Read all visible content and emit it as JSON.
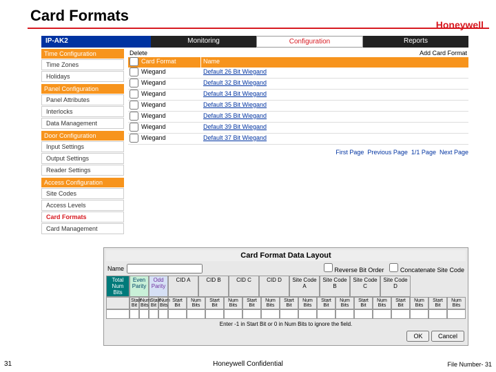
{
  "slide": {
    "title": "Card Formats",
    "brand": "Honeywell"
  },
  "nav": {
    "title": "IP-AK2",
    "monitoring": "Monitoring",
    "configuration": "Configuration",
    "reports": "Reports"
  },
  "sidebar": {
    "g0": {
      "head": "Time Configuration",
      "i0": "Time Zones",
      "i1": "Holidays"
    },
    "g1": {
      "head": "Panel Configuration",
      "i0": "Panel Attributes",
      "i1": "Interlocks",
      "i2": "Data Management"
    },
    "g2": {
      "head": "Door Configuration",
      "i0": "Input Settings",
      "i1": "Output Settings",
      "i2": "Reader Settings"
    },
    "g3": {
      "head": "Access Configuration",
      "i0": "Site Codes",
      "i1": "Access Levels",
      "i2": "Card Formats",
      "i3": "Card Management"
    }
  },
  "table": {
    "delete": "Delete",
    "add": "Add Card Format",
    "h1": "Card Format",
    "h2": "Name",
    "cf": "Wiegand",
    "r0": "Default 26 Bit Wiegand",
    "r1": "Default 32 Bit Wiegand",
    "r2": "Default 34 Bit Wiegand",
    "r3": "Default 35 Bit Wiegand",
    "r4": "Default 35 Bit Wiegand",
    "r5": "Default 39 Bit Wiegand",
    "r6": "Default 37 Bit Wiegand"
  },
  "pager": {
    "first": "First Page",
    "prev": "Previous Page",
    "cur": "1/1 Page",
    "next": "Next Page"
  },
  "layout": {
    "title": "Card Format Data Layout",
    "name": "Name",
    "reverse": "Reverse Bit Order",
    "concat": "Concatenate Site Code",
    "totnum": "Total Num Bits",
    "even": "Even Parity",
    "odd": "Odd Parity",
    "cida": "CID A",
    "cidb": "CID B",
    "cidc": "CID C",
    "cidd": "CID D",
    "sca": "Site Code A",
    "scb": "Site Code B",
    "scc": "Site Code C",
    "scd": "Site Code D",
    "start": "Start Bit",
    "num": "Num Bits",
    "hint": "Enter -1 in Start Bit or 0 in Num Bits to ignore the field.",
    "ok": "OK",
    "cancel": "Cancel"
  },
  "footer": {
    "page": "31",
    "conf": "Honeywell Confidential",
    "filenum": "File Number- 31"
  }
}
